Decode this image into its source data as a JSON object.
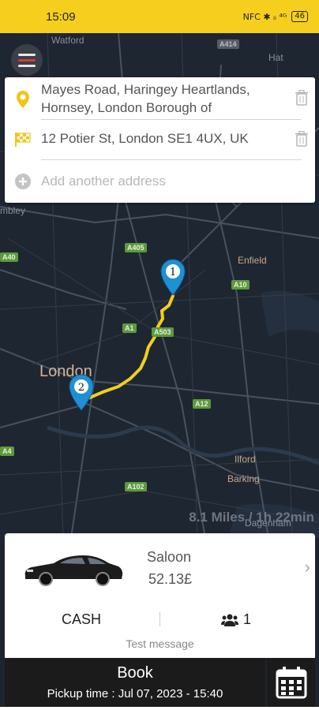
{
  "status_bar": {
    "time": "15:09",
    "icons_text": "NFC ✱ ᵢᵢ ⁴ᴳ",
    "battery": "46"
  },
  "map": {
    "labels": {
      "watford": "Watford",
      "hat": "Hat",
      "wembley": "mbley",
      "enfield": "Enfield",
      "london": "London",
      "ilford": "Ilford",
      "barking": "Barking",
      "dagenham": "Dagenham"
    },
    "roads": {
      "a414": "A414",
      "a405": "A405",
      "a10": "A10",
      "a1": "A1",
      "a503": "A503",
      "a12": "A12",
      "a102": "A102",
      "a40": "A40",
      "a4": "A4"
    },
    "markers": {
      "start": "1",
      "end": "2"
    },
    "distance_text": "8.1 Miles / 1h 22min"
  },
  "addresses": {
    "pickup": "Mayes Road, Haringey Heartlands, Hornsey, London Borough of",
    "dropoff": "12 Potier St, London SE1 4UX, UK",
    "add_placeholder": "Add another address"
  },
  "vehicle": {
    "name": "Saloon",
    "price": "52.13£",
    "payment": "CASH",
    "passengers": "1",
    "message": "Test message"
  },
  "booking": {
    "book_label": "Book",
    "pickup_time": "Pickup time : Jul 07, 2023 - 15:40"
  },
  "colors": {
    "accent_yellow": "#f6cf1e",
    "marker_blue": "#1e90d6",
    "map_bg": "#1e2632",
    "route": "#f3cf1b"
  },
  "icons": {
    "menu": "hamburger-icon",
    "pickup": "location-pin-icon",
    "dropoff": "checkered-flag-icon",
    "delete": "trash-icon",
    "add": "plus-circle-icon",
    "chevron": "chevron-right-icon",
    "passengers": "users-icon",
    "calendar": "calendar-icon"
  }
}
